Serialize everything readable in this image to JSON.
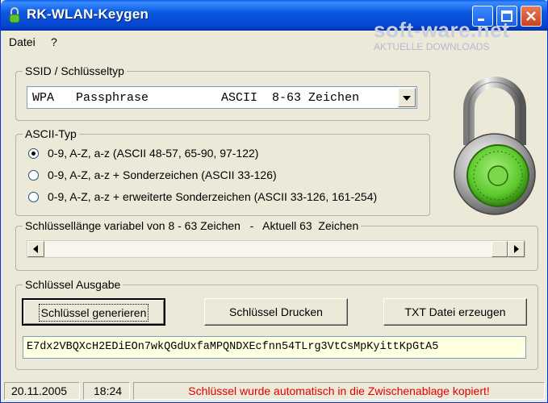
{
  "window": {
    "title": "RK-WLAN-Keygen"
  },
  "watermark": {
    "brand": "soft-ware.net",
    "tagline": "AKTUELLE DOWNLOADS"
  },
  "menu": {
    "items": [
      "Datei",
      "?"
    ]
  },
  "ssid_group": {
    "legend": "SSID / Schlüsseltyp",
    "selected": "WPA   Passphrase          ASCII  8-63 Zeichen"
  },
  "ascii_group": {
    "legend": "ASCII-Typ",
    "options": [
      {
        "label": "0-9, A-Z, a-z  (ASCII 48-57, 65-90, 97-122)",
        "checked": true
      },
      {
        "label": "0-9, A-Z, a-z + Sonderzeichen (ASCII 33-126)",
        "checked": false
      },
      {
        "label": "0-9, A-Z, a-z + erweiterte Sonderzeichen (ASCII 33-126, 161-254)",
        "checked": false
      }
    ]
  },
  "length_group": {
    "legend": "Schlüssellänge variabel von 8 - 63 Zeichen   -   Aktuell 63  Zeichen",
    "min": 8,
    "max": 63,
    "current": 63
  },
  "output_group": {
    "legend": "Schlüssel Ausgabe",
    "buttons": {
      "generate": "Schlüssel generieren",
      "print": "Schlüssel Drucken",
      "txt": "TXT Datei erzeugen"
    },
    "key": "E7dx2VBQXcH2EDiEOn7wkQGdUxfaMPQNDXEcfnn54TLrg3VtCsMpKyittKpGtA5"
  },
  "status": {
    "date": "20.11.2005",
    "time": "18:24",
    "message": "Schlüssel wurde automatisch in die Zwischenablage kopiert!"
  },
  "colors": {
    "title_bar": "#0b5ae0",
    "dialog_bg": "#ece9d8",
    "output_bg": "#ffffe1",
    "status_message": "#e00000",
    "lock_dial": "#6fd23a"
  }
}
